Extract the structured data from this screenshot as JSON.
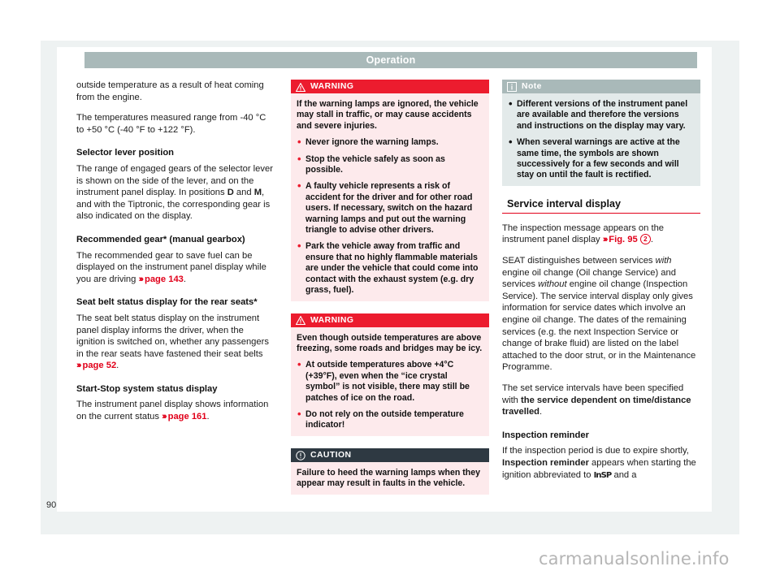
{
  "document": {
    "running_head": "Operation",
    "page_number": "90",
    "watermark": "carmanualsonline.info"
  },
  "column_left": {
    "paragraph_continued": "outside temperature as a result of heat coming from the engine.",
    "paragraph_temp_range": "The temperatures measured range from -40 °C to +50 °C (-40 °F to +122 °F).",
    "heading_selector": "Selector lever position",
    "selector_text_1": "The range of engaged gears of the selector lever is shown on the side of the lever, and on the instrument panel display. In positions ",
    "selector_bold_d": "D",
    "selector_text_2": " and ",
    "selector_bold_m": "M",
    "selector_text_3": ", and with the Tiptronic, the corresponding gear is also indicated on the display.",
    "heading_recommended_gear": "Recommended gear* (manual gearbox)",
    "recommended_gear_text": "The recommended gear to save fuel can be displayed on the instrument panel display while you are driving ",
    "recommended_gear_ref": "page 143",
    "heading_seat_belt": "Seat belt status display for the rear seats*",
    "seat_belt_text": "The seat belt status display on the instrument panel display informs the driver, when the ignition is switched on, whether any passengers in the rear seats have fastened their seat belts ",
    "seat_belt_ref": "page 52",
    "heading_start_stop": "Start-Stop system status display",
    "start_stop_text": "The instrument panel display shows information on the current status ",
    "start_stop_ref": "page 161"
  },
  "column_middle": {
    "warning_1": {
      "label": "WARNING",
      "icon": "warning-triangle-icon",
      "lead": "If the warning lamps are ignored, the vehicle may stall in traffic, or may cause accidents and severe injuries.",
      "bullets": [
        "Never ignore the warning lamps.",
        "Stop the vehicle safely as soon as possible.",
        "A faulty vehicle represents a risk of accident for the driver and for other road users. If necessary, switch on the hazard warning lamps and put out the warning triangle to advise other drivers.",
        "Park the vehicle away from traffic and ensure that no highly flammable materials are under the vehicle that could come into contact with the exhaust system (e.g. dry grass, fuel)."
      ]
    },
    "warning_2": {
      "label": "WARNING",
      "icon": "warning-triangle-icon",
      "lead": "Even though outside temperatures are above freezing, some roads and bridges may be icy.",
      "bullets": [
        "At outside temperatures above +4°C (+39°F), even when the “ice crystal symbol” is not visible, there may still be patches of ice on the road.",
        "Do not rely on the outside temperature indicator!"
      ]
    },
    "caution": {
      "label": "CAUTION",
      "icon": "exclamation-circle-icon",
      "lead": "Failure to heed the warning lamps when they appear may result in faults in the vehicle.",
      "bullets": []
    }
  },
  "column_right": {
    "note": {
      "label": "Note",
      "icon": "info-icon",
      "bullets": [
        "Different versions of the instrument panel are available and therefore the versions and instructions on the display may vary.",
        "When several warnings are active at the same time, the symbols are shown successively for a few seconds and will stay on until the fault is rectified."
      ]
    },
    "section_heading": "Service interval display",
    "para_1_text": "The inspection message appears on the instrument panel display ",
    "para_1_ref": "Fig. 95",
    "para_1_callout": "2",
    "para_2_a": "SEAT distinguishes between services ",
    "para_2_i1": "with",
    "para_2_b": " engine oil change (Oil change Service) and services ",
    "para_2_i2": "without",
    "para_2_c": " engine oil change (Inspection Service). The service interval display only gives information for service dates which involve an engine oil change. The dates of the remaining services (e.g. the next Inspection Service or change of brake fluid) are listed on the label attached to the door strut, or in the Maintenance Programme.",
    "para_3_a": "The set service intervals have been specified with ",
    "para_3_bold": "the service dependent on time/distance travelled",
    "para_3_b": ".",
    "heading_inspection_reminder": "Inspection reminder",
    "para_4_a": "If the inspection period is due to expire shortly, ",
    "para_4_bold": "Inspection reminder",
    "para_4_b": " appears when starting the ignition abbreviated to ",
    "para_4_symbol": "InSP",
    "para_4_c": " and a"
  },
  "colors": {
    "warning_red": "#ec1c2e",
    "warning_bg": "#fdeaec",
    "caution_dark": "#2e3942",
    "note_gray": "#a9b9b9",
    "note_bg": "#e3eaea",
    "xref_red": "#e1001a",
    "head_gray": "#a9b9b9"
  }
}
